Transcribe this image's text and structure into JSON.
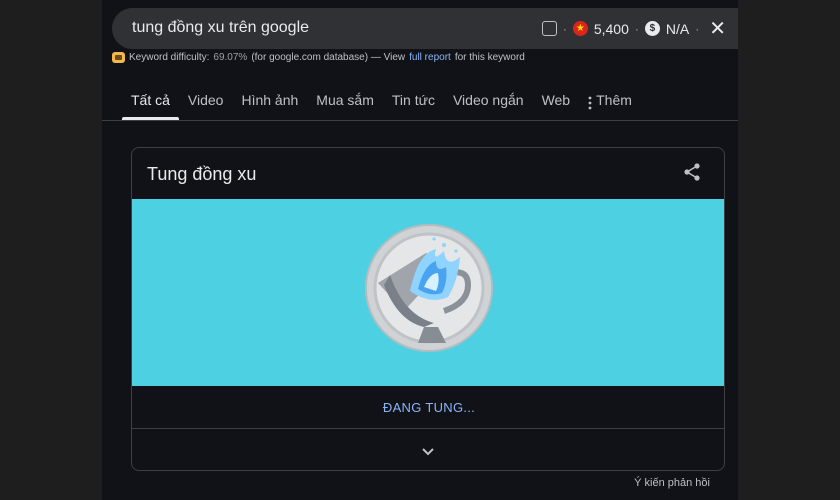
{
  "search": {
    "query": "tung đồng xu trên google",
    "volume": "5,400",
    "cpc": "N/A",
    "separator": "·"
  },
  "keyword": {
    "label": "Keyword difficulty:",
    "value": "69.07%",
    "database": "(for google.com database) — View",
    "link": "full report",
    "suffix": "for this keyword"
  },
  "tabs": [
    {
      "label": "Tất cả",
      "active": true
    },
    {
      "label": "Video"
    },
    {
      "label": "Hình ảnh"
    },
    {
      "label": "Mua sắm"
    },
    {
      "label": "Tin tức"
    },
    {
      "label": "Video ngắn"
    },
    {
      "label": "Web"
    },
    {
      "label": "Thêm"
    }
  ],
  "card": {
    "title": "Tung đồng xu",
    "status": "ĐANG TUNG..."
  },
  "feedback": "Ý kiến phản hồi",
  "colors": {
    "page_bg": "#111217",
    "search_bg": "#303134",
    "coin_bg": "#4dd0e1",
    "link": "#8ab4f8",
    "text": "#e8eaed"
  },
  "icons": {
    "close": "close-icon",
    "share": "share-icon",
    "chevron": "chevron-down-icon",
    "more": "more-vert-icon"
  }
}
